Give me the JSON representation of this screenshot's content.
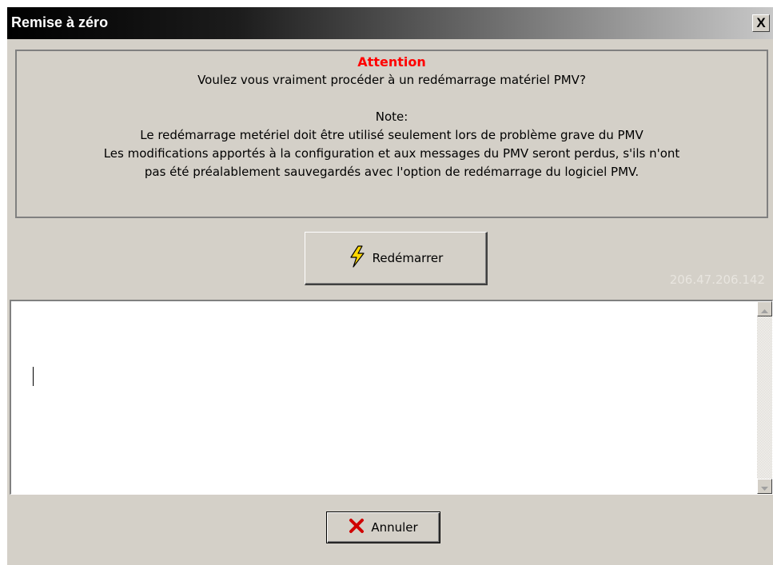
{
  "window": {
    "title": "Remise à zéro",
    "close_glyph": "X"
  },
  "message": {
    "heading": "Attention",
    "question": "Voulez vous vraiment procéder à un redémarrage matériel PMV?",
    "note_label": "Note:",
    "note_line_1": "Le redémarrage metériel doit être utilisé seulement lors de problème grave du PMV",
    "note_line_2": "Les modifications apportés à la configuration et aux messages du PMV seront perdus, s'ils n'ont",
    "note_line_3": "pas été préalablement sauvegardés avec l'option de redémarrage du logiciel PMV."
  },
  "restart_button": {
    "label": "Redémarrer",
    "icon": "lightning-icon"
  },
  "device_ip": "206.47.206.142",
  "output_text": "",
  "cancel_button": {
    "label": "Annuler",
    "icon": "red-x-icon"
  },
  "colors": {
    "attention": "#ff0000",
    "dialog_face": "#d4d0c8",
    "ip_text": "#e8e5df"
  }
}
